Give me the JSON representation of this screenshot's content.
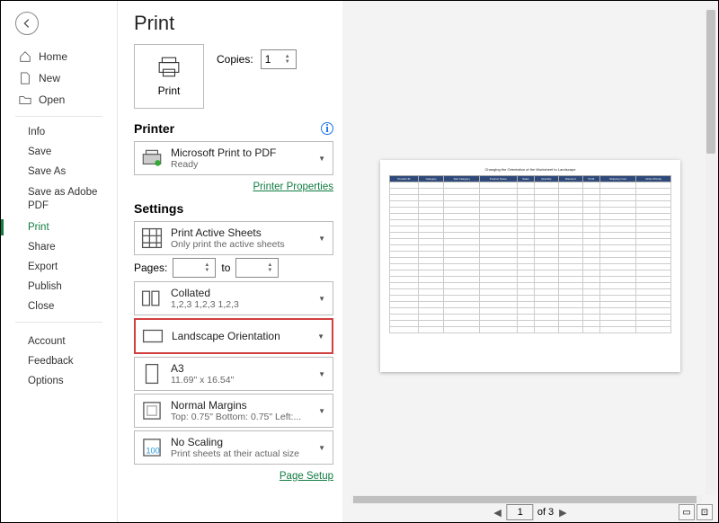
{
  "pageTitle": "Print",
  "sidebar": {
    "top": [
      {
        "label": "Home"
      },
      {
        "label": "New"
      },
      {
        "label": "Open"
      }
    ],
    "mid": [
      {
        "label": "Info"
      },
      {
        "label": "Save"
      },
      {
        "label": "Save As"
      },
      {
        "label": "Save as Adobe PDF"
      },
      {
        "label": "Print"
      },
      {
        "label": "Share"
      },
      {
        "label": "Export"
      },
      {
        "label": "Publish"
      },
      {
        "label": "Close"
      }
    ],
    "bot": [
      {
        "label": "Account"
      },
      {
        "label": "Feedback"
      },
      {
        "label": "Options"
      }
    ]
  },
  "printBtn": "Print",
  "copiesLabel": "Copies:",
  "copiesValue": "1",
  "printerHead": "Printer",
  "printer": {
    "l1": "Microsoft Print to PDF",
    "l2": "Ready"
  },
  "printerPropsLink": "Printer Properties",
  "settingsHead": "Settings",
  "pagesLabel": "Pages:",
  "pagesTo": "to",
  "settings": {
    "active": {
      "l1": "Print Active Sheets",
      "l2": "Only print the active sheets"
    },
    "collated": {
      "l1": "Collated",
      "l2": "1,2,3   1,2,3   1,2,3"
    },
    "orient": {
      "l1": "Landscape Orientation",
      "l2": ""
    },
    "paper": {
      "l1": "A3",
      "l2": "11.69\" x 16.54\""
    },
    "margins": {
      "l1": "Normal Margins",
      "l2": "Top: 0.75\" Bottom: 0.75\" Left:..."
    },
    "scaling": {
      "l1": "No Scaling",
      "l2": "Print sheets at their actual size"
    }
  },
  "pageSetupLink": "Page Setup",
  "pageNav": {
    "current": "1",
    "total": "of 3"
  },
  "preview": {
    "title": "Changing the Orientation of the Worksheet to Landscape",
    "headers": [
      "Product ID",
      "Category",
      "Sub Category",
      "Product Name",
      "Sales",
      "Quantity",
      "Discount",
      "Profit",
      "Shipping Cost",
      "Order Priority"
    ]
  }
}
